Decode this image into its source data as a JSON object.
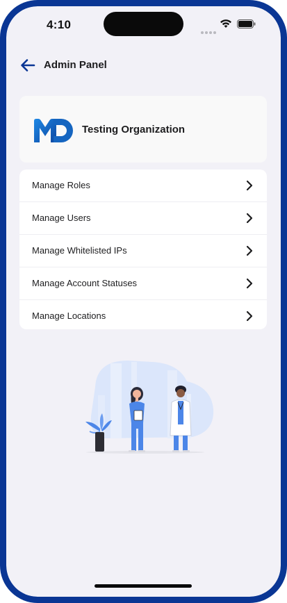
{
  "status_bar": {
    "time": "4:10"
  },
  "header": {
    "title": "Admin Panel"
  },
  "organization": {
    "name": "Testing Organization",
    "logo": "MD"
  },
  "menu": {
    "items": [
      {
        "label": "Manage Roles"
      },
      {
        "label": "Manage Users"
      },
      {
        "label": "Manage Whitelisted IPs"
      },
      {
        "label": "Manage Account Statuses"
      },
      {
        "label": "Manage Locations"
      }
    ]
  },
  "colors": {
    "frame": "#0a3694",
    "accent": "#1565c0",
    "background": "#f2f1f7"
  },
  "icons": [
    "back-arrow-icon",
    "chevron-right-icon",
    "wifi-icon",
    "battery-icon",
    "signal-icon"
  ]
}
